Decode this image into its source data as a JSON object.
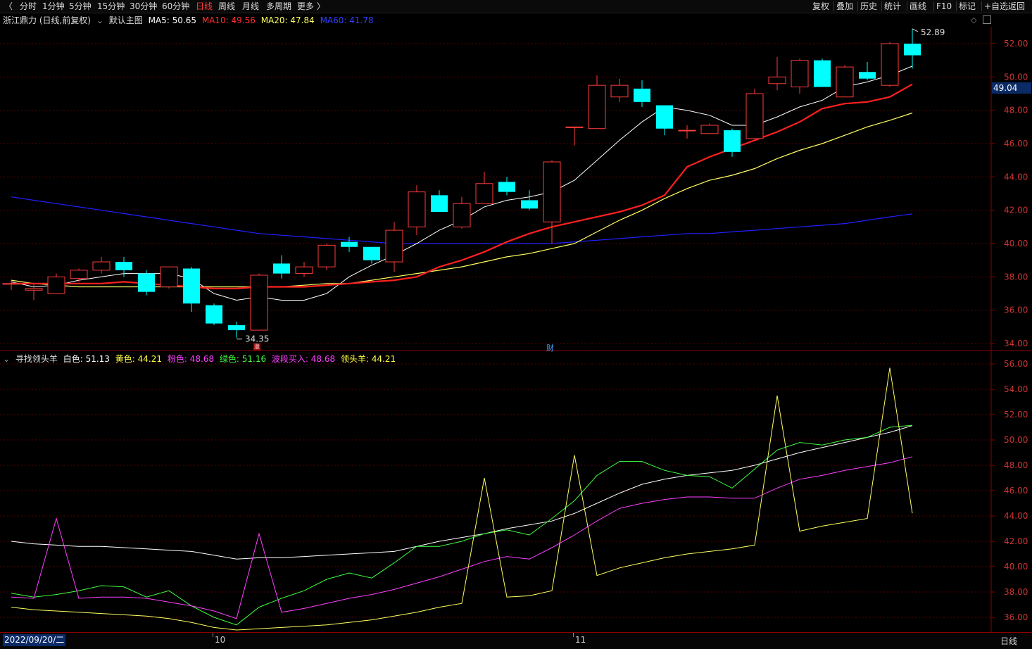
{
  "toolbar": {
    "left": [
      "分时",
      "1分钟",
      "5分钟",
      "15分钟",
      "30分钟",
      "60分钟",
      "日线",
      "周线",
      "月线",
      "多周期",
      "更多 〉"
    ],
    "active": "日线",
    "right": [
      "复权",
      "叠加",
      "历史",
      "统计",
      "画线",
      "F10",
      "标记",
      "+自选",
      "返回"
    ],
    "left_arrow": "〈"
  },
  "main_header": {
    "stock": "浙江鼎力 (日线,前复权)",
    "template": "默认主图",
    "ma5": "MA5: 50.65",
    "ma10": "MA10: 49.56",
    "ma20": "MA20: 47.84",
    "ma60": "MA60: 41.78"
  },
  "sub_header": {
    "indicator": "寻找领头羊",
    "white": "白色: 51.13",
    "yellow": "黄色: 44.21",
    "pink": "粉色: 48.68",
    "green": "绿色: 51.16",
    "band": "波段买入: 48.68",
    "leader": "领头羊: 44.21"
  },
  "price_axis": [
    "52.00",
    "50.00",
    "48.00",
    "46.00",
    "44.00",
    "42.00",
    "40.00",
    "38.00",
    "36.00",
    "34.00"
  ],
  "sub_axis": [
    "56.00",
    "54.00",
    "52.00",
    "50.00",
    "48.00",
    "46.00",
    "44.00",
    "42.00",
    "40.00",
    "38.00",
    "36.00"
  ],
  "last_price": "49.04",
  "high_mark": "52.89",
  "low_mark": "34.35",
  "marker_zhang": "涨",
  "marker_cai": "财",
  "bottom": {
    "date": "2022/09/20/二",
    "month10": "10",
    "month11": "11",
    "period": "日线"
  },
  "colors": {
    "up": "#ff3c3c",
    "down": "#00ffff",
    "ma5": "#ffffff",
    "ma10": "#ff2020",
    "ma20": "#ffff60",
    "ma60": "#2020ff"
  },
  "chart_data": {
    "type": "candlestick",
    "dates_label_start": "2022/09/20",
    "candles": [
      {
        "o": 37.6,
        "h": 37.8,
        "l": 37.2,
        "c": 37.6
      },
      {
        "o": 37.2,
        "h": 37.6,
        "l": 36.6,
        "c": 37.3
      },
      {
        "o": 37.0,
        "h": 38.2,
        "l": 37.0,
        "c": 38.0
      },
      {
        "o": 37.9,
        "h": 38.5,
        "l": 37.7,
        "c": 38.4
      },
      {
        "o": 38.4,
        "h": 39.2,
        "l": 38.2,
        "c": 38.9
      },
      {
        "o": 38.9,
        "h": 39.2,
        "l": 38.0,
        "c": 38.4
      },
      {
        "o": 38.2,
        "h": 38.4,
        "l": 36.9,
        "c": 37.1
      },
      {
        "o": 37.4,
        "h": 38.6,
        "l": 37.3,
        "c": 38.6
      },
      {
        "o": 38.5,
        "h": 38.6,
        "l": 35.9,
        "c": 36.4
      },
      {
        "o": 36.3,
        "h": 36.4,
        "l": 35.1,
        "c": 35.2
      },
      {
        "o": 35.1,
        "h": 35.3,
        "l": 34.35,
        "c": 34.8
      },
      {
        "o": 34.8,
        "h": 38.2,
        "l": 34.8,
        "c": 38.1
      },
      {
        "o": 38.8,
        "h": 39.3,
        "l": 37.9,
        "c": 38.2
      },
      {
        "o": 38.2,
        "h": 38.9,
        "l": 38.0,
        "c": 38.6
      },
      {
        "o": 38.6,
        "h": 40.0,
        "l": 38.4,
        "c": 39.9
      },
      {
        "o": 40.1,
        "h": 40.4,
        "l": 39.5,
        "c": 39.8
      },
      {
        "o": 39.8,
        "h": 39.8,
        "l": 38.8,
        "c": 39.0
      },
      {
        "o": 38.9,
        "h": 41.3,
        "l": 38.3,
        "c": 40.8
      },
      {
        "o": 41.0,
        "h": 43.5,
        "l": 40.5,
        "c": 43.1
      },
      {
        "o": 42.9,
        "h": 43.2,
        "l": 41.9,
        "c": 41.9
      },
      {
        "o": 41.0,
        "h": 42.8,
        "l": 40.9,
        "c": 42.4
      },
      {
        "o": 42.4,
        "h": 44.3,
        "l": 42.4,
        "c": 43.6
      },
      {
        "o": 43.7,
        "h": 44.0,
        "l": 42.9,
        "c": 43.1
      },
      {
        "o": 42.6,
        "h": 43.2,
        "l": 42.0,
        "c": 42.1
      },
      {
        "o": 41.3,
        "h": 45.0,
        "l": 40.0,
        "c": 44.9
      },
      {
        "o": 47.0,
        "h": 47.0,
        "l": 45.9,
        "c": 47.0
      },
      {
        "o": 46.9,
        "h": 50.1,
        "l": 46.9,
        "c": 49.5
      },
      {
        "o": 48.8,
        "h": 49.9,
        "l": 48.5,
        "c": 49.5
      },
      {
        "o": 49.3,
        "h": 49.8,
        "l": 48.2,
        "c": 48.5
      },
      {
        "o": 48.3,
        "h": 48.3,
        "l": 46.5,
        "c": 46.9
      },
      {
        "o": 46.8,
        "h": 47.1,
        "l": 46.3,
        "c": 46.8
      },
      {
        "o": 46.6,
        "h": 47.2,
        "l": 46.6,
        "c": 47.1
      },
      {
        "o": 46.8,
        "h": 46.9,
        "l": 45.2,
        "c": 45.5
      },
      {
        "o": 46.3,
        "h": 49.3,
        "l": 46.3,
        "c": 49.0
      },
      {
        "o": 49.6,
        "h": 51.2,
        "l": 49.2,
        "c": 50.0
      },
      {
        "o": 49.4,
        "h": 51.1,
        "l": 49.0,
        "c": 51.0
      },
      {
        "o": 51.0,
        "h": 51.1,
        "l": 49.5,
        "c": 49.4
      },
      {
        "o": 48.8,
        "h": 50.7,
        "l": 48.8,
        "c": 50.6
      },
      {
        "o": 50.3,
        "h": 50.9,
        "l": 49.8,
        "c": 49.9
      },
      {
        "o": 49.5,
        "h": 52.1,
        "l": 49.4,
        "c": 52.0
      },
      {
        "o": 52.0,
        "h": 52.89,
        "l": 50.5,
        "c": 51.3
      }
    ],
    "ma5": [
      37.7,
      37.4,
      37.5,
      37.8,
      38.0,
      38.2,
      38.2,
      38.2,
      37.9,
      37.0,
      36.6,
      36.8,
      36.6,
      36.6,
      37.0,
      38.0,
      38.7,
      39.3,
      40.0,
      40.8,
      41.4,
      42.2,
      42.6,
      42.8,
      43.1,
      43.8,
      45.0,
      46.2,
      47.3,
      48.2,
      48.0,
      47.7,
      47.1,
      47.1,
      47.6,
      48.2,
      48.6,
      49.4,
      49.7,
      50.1,
      50.65
    ],
    "ma10": [
      37.6,
      37.6,
      37.6,
      37.6,
      37.6,
      37.7,
      37.6,
      37.5,
      37.4,
      37.3,
      37.3,
      37.4,
      37.4,
      37.4,
      37.5,
      37.6,
      37.7,
      37.8,
      38.0,
      38.6,
      39.0,
      39.5,
      40.1,
      40.6,
      41.0,
      41.3,
      41.6,
      41.9,
      42.3,
      42.9,
      44.6,
      45.2,
      45.7,
      46.2,
      46.7,
      47.3,
      48.1,
      48.4,
      48.5,
      48.8,
      49.56
    ],
    "ma20": [
      37.8,
      37.6,
      37.5,
      37.4,
      37.4,
      37.4,
      37.4,
      37.4,
      37.4,
      37.4,
      37.4,
      37.4,
      37.4,
      37.5,
      37.6,
      37.6,
      37.8,
      38.0,
      38.2,
      38.4,
      38.6,
      38.9,
      39.2,
      39.4,
      39.7,
      40.0,
      40.7,
      41.4,
      42.0,
      42.7,
      43.3,
      43.8,
      44.1,
      44.5,
      45.1,
      45.6,
      46.0,
      46.5,
      47.0,
      47.4,
      47.84
    ],
    "ma60": [
      42.8,
      42.6,
      42.4,
      42.2,
      42.0,
      41.8,
      41.6,
      41.4,
      41.2,
      41.0,
      40.8,
      40.6,
      40.5,
      40.4,
      40.3,
      40.2,
      40.1,
      40.0,
      40.0,
      40.0,
      40.0,
      40.0,
      40.0,
      40.0,
      40.0,
      40.1,
      40.2,
      40.3,
      40.4,
      40.5,
      40.6,
      40.6,
      40.7,
      40.8,
      40.9,
      41.0,
      41.1,
      41.2,
      41.4,
      41.6,
      41.78
    ],
    "sub": {
      "white": [
        42.0,
        41.8,
        41.7,
        41.6,
        41.6,
        41.5,
        41.4,
        41.3,
        41.2,
        40.9,
        40.6,
        40.7,
        40.7,
        40.8,
        40.9,
        41.0,
        41.1,
        41.2,
        41.6,
        42.0,
        42.3,
        42.6,
        43.0,
        43.3,
        43.6,
        44.2,
        45.0,
        45.8,
        46.5,
        46.9,
        47.2,
        47.4,
        47.6,
        48.0,
        48.5,
        49.0,
        49.4,
        49.8,
        50.2,
        50.6,
        51.13
      ],
      "green": [
        37.9,
        37.6,
        37.8,
        38.1,
        38.5,
        38.4,
        37.6,
        38.1,
        36.9,
        36.0,
        35.4,
        36.8,
        37.5,
        38.1,
        39.0,
        39.5,
        39.1,
        40.3,
        41.6,
        41.6,
        42.0,
        42.6,
        42.9,
        42.5,
        43.8,
        45.2,
        47.2,
        48.3,
        48.3,
        47.6,
        47.2,
        47.1,
        46.2,
        47.7,
        49.2,
        49.8,
        49.6,
        50.0,
        50.2,
        51.0,
        51.16
      ],
      "pink": [
        37.6,
        37.5,
        37.5,
        37.5,
        37.6,
        37.6,
        37.5,
        37.2,
        36.9,
        36.5,
        35.9,
        36.1,
        36.4,
        36.7,
        37.1,
        37.5,
        37.8,
        38.2,
        38.7,
        39.2,
        39.8,
        40.4,
        40.8,
        40.6,
        41.5,
        42.5,
        43.6,
        44.6,
        45.0,
        45.3,
        45.5,
        45.5,
        45.4,
        45.4,
        46.2,
        46.9,
        47.2,
        47.6,
        47.9,
        48.2,
        48.68
      ],
      "yellow": [
        36.8,
        36.6,
        36.5,
        36.4,
        36.3,
        36.2,
        36.1,
        35.9,
        35.6,
        35.2,
        35.0,
        35.1,
        35.2,
        35.3,
        35.4,
        35.6,
        35.8,
        36.1,
        36.4,
        36.8,
        37.1,
        37.4,
        37.6,
        37.7,
        38.1,
        38.6,
        39.3,
        39.9,
        40.3,
        40.7,
        41.0,
        41.2,
        41.4,
        41.7,
        42.3,
        42.8,
        43.2,
        43.5,
        43.8,
        44.0,
        44.21
      ],
      "pink_spikes": [
        [
          2,
          43.8
        ],
        [
          11,
          42.6
        ]
      ],
      "yellow_spikes": [
        [
          21,
          47.0
        ],
        [
          25,
          48.8
        ],
        [
          34,
          53.5
        ],
        [
          39,
          55.7
        ]
      ]
    }
  }
}
